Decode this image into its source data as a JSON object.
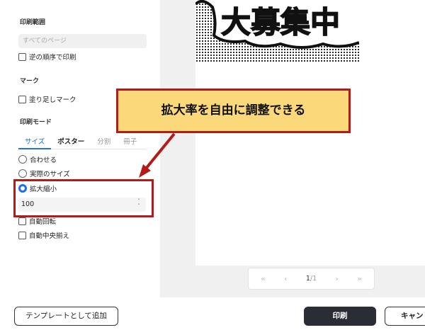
{
  "print_range": {
    "label": "印刷範囲",
    "page_select": "すべてのページ",
    "reverse_order": "逆の順序で印刷"
  },
  "marks": {
    "label": "マーク",
    "bleed": "塗り足しマーク"
  },
  "print_mode": {
    "label": "印刷モード",
    "tabs": [
      "サイズ",
      "ポスター",
      "分割",
      "冊子"
    ],
    "options": [
      "合わせる",
      "実際のサイズ",
      "拡大縮小"
    ],
    "scale_value": "100",
    "auto_rotate": "自動回転",
    "auto_center": "自動中央揃え"
  },
  "preview": {
    "comic_text": "大募集中",
    "pager": {
      "first": "«",
      "prev": "‹",
      "current": "1",
      "total": "/1",
      "next": "›",
      "last": "»"
    }
  },
  "buttons": {
    "template": "テンプレートとして追加",
    "print": "印刷",
    "cancel": "キャン"
  },
  "callout": {
    "text": "拡大率を自由に調整できる",
    "border_color": "#b51a1a",
    "fill_color": "#fbd87a"
  },
  "colors": {
    "accent": "#1f6fe5",
    "primary_button": "#2a2d35",
    "preview_bg": "#f0f0f0"
  }
}
